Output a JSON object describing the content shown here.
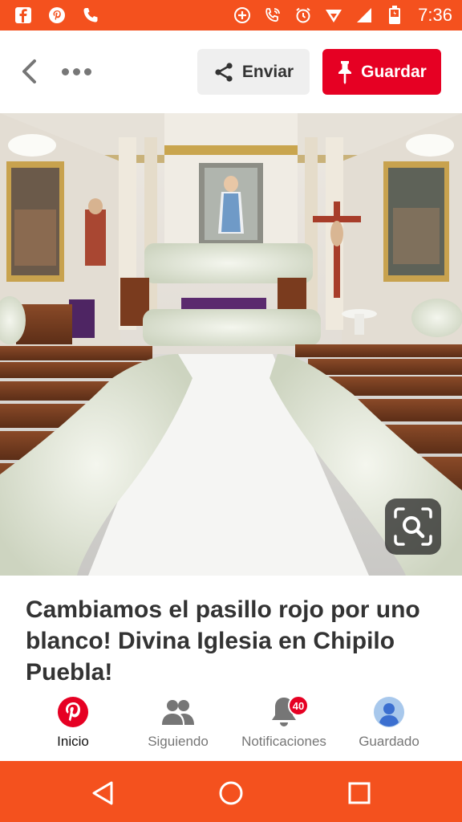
{
  "status_bar": {
    "time": "7:36",
    "left_icons": [
      "facebook-icon",
      "pinterest-icon",
      "phone-icon"
    ],
    "right_icons": [
      "add-circle-icon",
      "wifi-call-icon",
      "alarm-icon",
      "signal-boost-icon",
      "cell-signal-icon",
      "battery-icon"
    ],
    "color": "#f4511e"
  },
  "header": {
    "send_label": "Enviar",
    "save_label": "Guardar",
    "save_color": "#e60023"
  },
  "pin": {
    "caption": "Cambiamos el pasillo rojo por uno blanco! Divina Iglesia en Chipilo Puebla!"
  },
  "bottom_nav": {
    "items": [
      {
        "label": "Inicio",
        "icon": "pinterest-logo-icon",
        "active": true
      },
      {
        "label": "Siguiendo",
        "icon": "people-icon"
      },
      {
        "label": "Notificaciones",
        "icon": "bell-icon",
        "badge": "40"
      },
      {
        "label": "Guardado",
        "icon": "avatar-icon"
      }
    ]
  },
  "android_nav": {
    "buttons": [
      "back-triangle-icon",
      "home-circle-icon",
      "recents-square-icon"
    ]
  }
}
